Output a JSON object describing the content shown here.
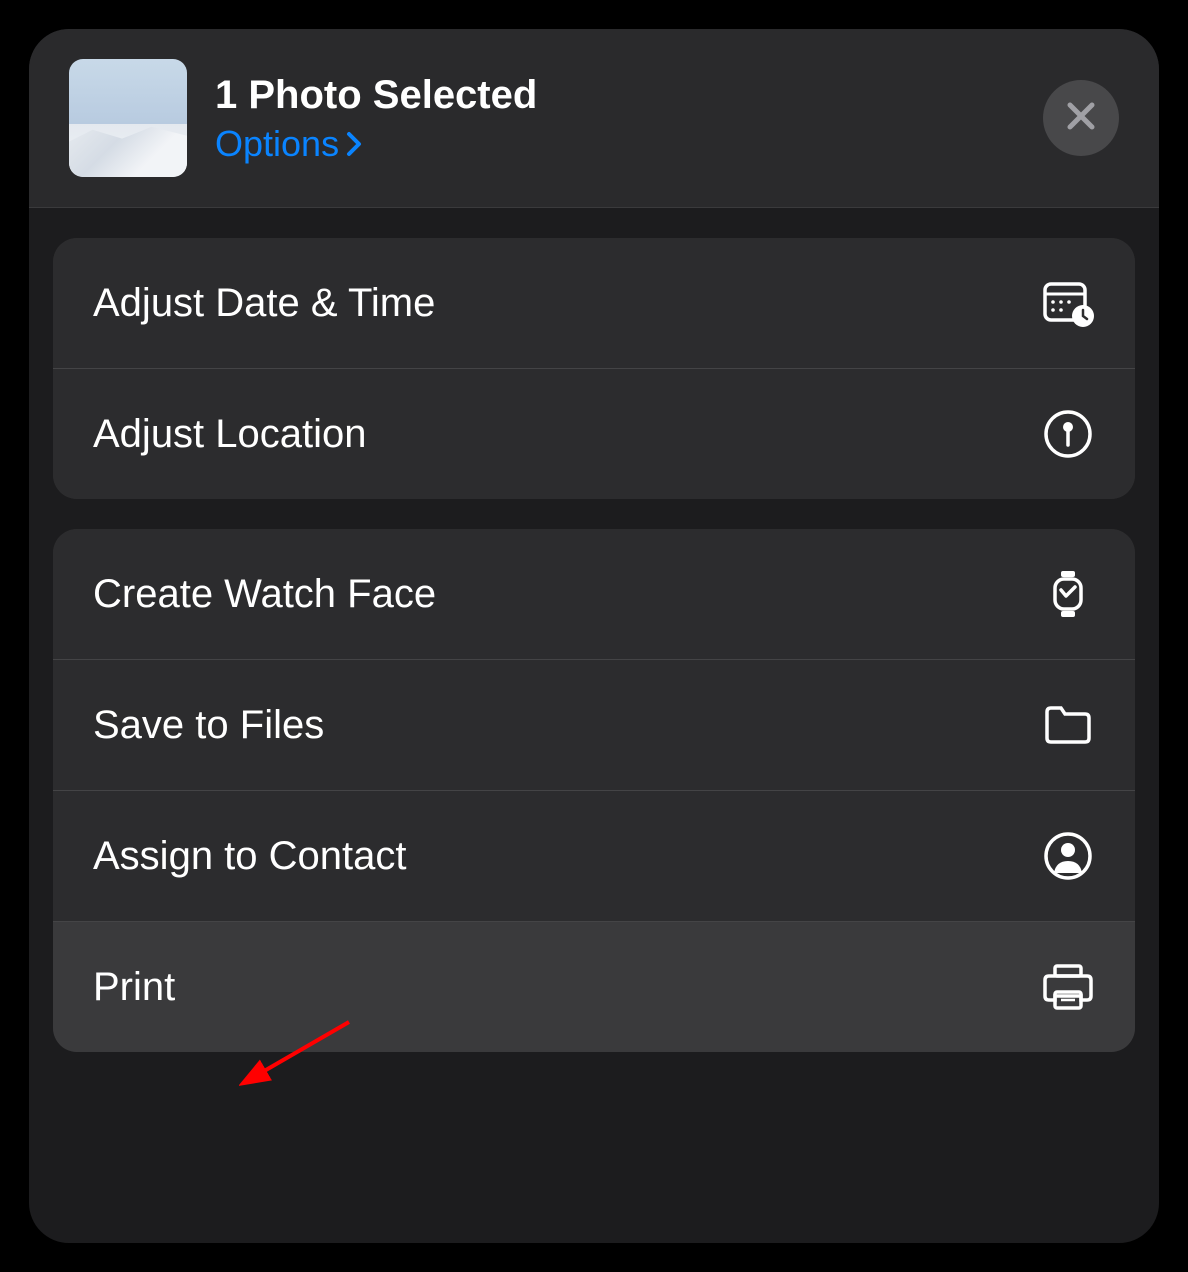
{
  "header": {
    "title": "1 Photo Selected",
    "options_label": "Options"
  },
  "groups": [
    {
      "rows": [
        {
          "label": "Adjust Date & Time",
          "icon": "calendar-clock-icon"
        },
        {
          "label": "Adjust Location",
          "icon": "location-pin-icon"
        }
      ]
    },
    {
      "rows": [
        {
          "label": "Create Watch Face",
          "icon": "watch-icon"
        },
        {
          "label": "Save to Files",
          "icon": "folder-icon"
        },
        {
          "label": "Assign to Contact",
          "icon": "contact-icon"
        },
        {
          "label": "Print",
          "icon": "printer-icon",
          "highlighted": true
        }
      ]
    }
  ]
}
